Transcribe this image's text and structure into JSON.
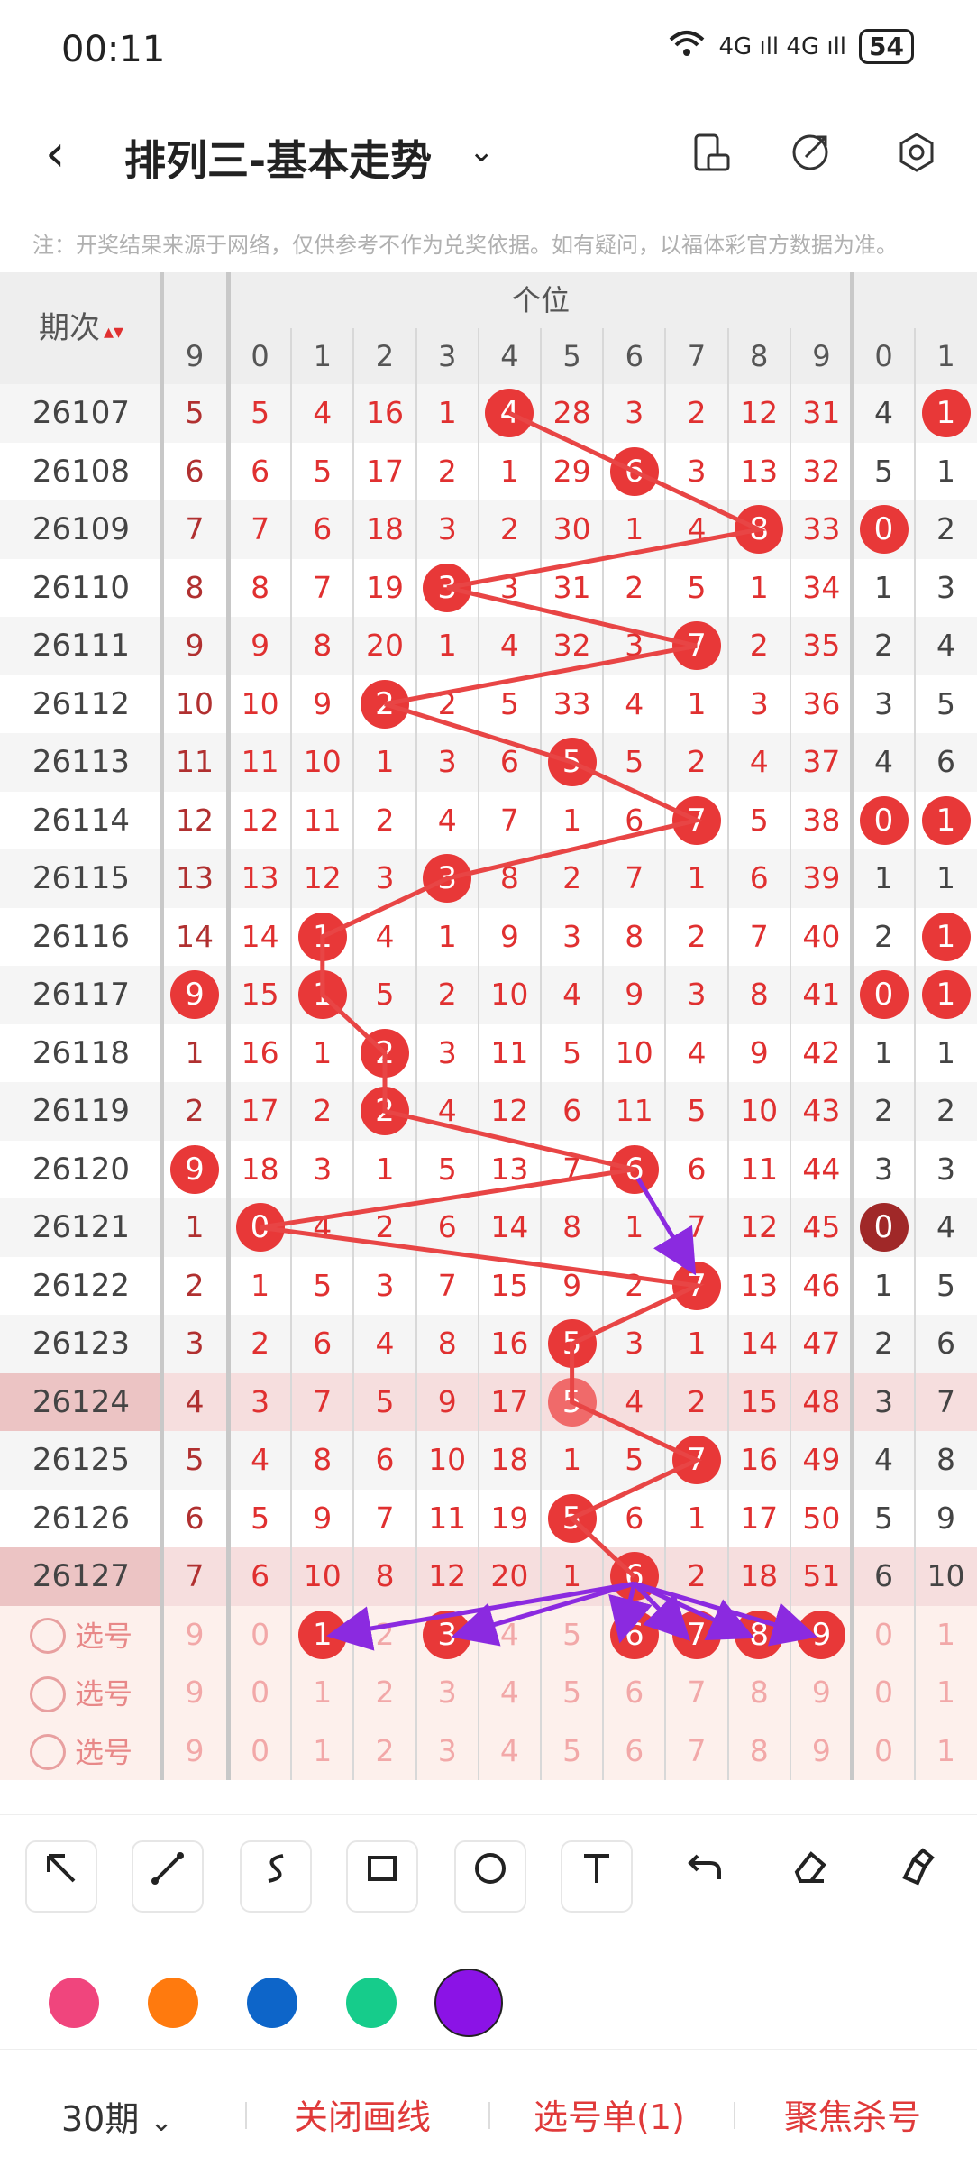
{
  "status_bar": {
    "time": "00:11",
    "signal": "4G ıll 4G ıll",
    "battery": "54"
  },
  "nav": {
    "title": "排列三-基本走势"
  },
  "note": "注：开奖结果来源于网络，仅供参考不作为兑奖依据。如有疑问，以福体彩官方数据为准。",
  "table": {
    "period_header": "期次",
    "group_header": "个位",
    "left_header": "9",
    "digit_headers": [
      "0",
      "1",
      "2",
      "3",
      "4",
      "5",
      "6",
      "7",
      "8",
      "9"
    ],
    "right_headers": [
      "0",
      "1"
    ],
    "rows": [
      {
        "period": "26107",
        "left": "5",
        "cells": [
          "5",
          "4",
          "16",
          "1",
          "4",
          "28",
          "3",
          "2",
          "12",
          "31"
        ],
        "hit": 4,
        "right": [
          "4",
          "1"
        ],
        "rhit": [
          1
        ]
      },
      {
        "period": "26108",
        "left": "6",
        "cells": [
          "6",
          "5",
          "17",
          "2",
          "1",
          "29",
          "6",
          "3",
          "13",
          "32"
        ],
        "hit": 6,
        "right": [
          "5",
          "1"
        ],
        "rhit": []
      },
      {
        "period": "26109",
        "left": "7",
        "cells": [
          "7",
          "6",
          "18",
          "3",
          "2",
          "30",
          "1",
          "4",
          "8",
          "33"
        ],
        "hit": 8,
        "right": [
          "0",
          "2"
        ],
        "rhit": [
          0
        ]
      },
      {
        "period": "26110",
        "left": "8",
        "cells": [
          "8",
          "7",
          "19",
          "3",
          "3",
          "31",
          "2",
          "5",
          "1",
          "34"
        ],
        "hit": 3,
        "right": [
          "1",
          "3"
        ],
        "rhit": []
      },
      {
        "period": "26111",
        "left": "9",
        "cells": [
          "9",
          "8",
          "20",
          "1",
          "4",
          "32",
          "3",
          "7",
          "2",
          "35"
        ],
        "hit": 7,
        "right": [
          "2",
          "4"
        ],
        "rhit": []
      },
      {
        "period": "26112",
        "left": "10",
        "cells": [
          "10",
          "9",
          "2",
          "2",
          "5",
          "33",
          "4",
          "1",
          "3",
          "36"
        ],
        "hit": 2,
        "right": [
          "3",
          "5"
        ],
        "rhit": []
      },
      {
        "period": "26113",
        "left": "11",
        "cells": [
          "11",
          "10",
          "1",
          "3",
          "6",
          "5",
          "5",
          "2",
          "4",
          "37"
        ],
        "hit": 5,
        "right": [
          "4",
          "6"
        ],
        "rhit": []
      },
      {
        "period": "26114",
        "left": "12",
        "cells": [
          "12",
          "11",
          "2",
          "4",
          "7",
          "1",
          "6",
          "7",
          "5",
          "38"
        ],
        "hit": 7,
        "right": [
          "0",
          "1"
        ],
        "rhit": [
          0,
          1
        ]
      },
      {
        "period": "26115",
        "left": "13",
        "cells": [
          "13",
          "12",
          "3",
          "3",
          "8",
          "2",
          "7",
          "1",
          "6",
          "39"
        ],
        "hit": 3,
        "right": [
          "1",
          "1"
        ],
        "rhit": []
      },
      {
        "period": "26116",
        "left": "14",
        "cells": [
          "14",
          "1",
          "4",
          "1",
          "9",
          "3",
          "8",
          "2",
          "7",
          "40"
        ],
        "hit": 1,
        "right": [
          "2",
          "1"
        ],
        "rhit": [
          1
        ]
      },
      {
        "period": "26117",
        "left": "9",
        "lefthit": true,
        "cells": [
          "15",
          "1",
          "5",
          "2",
          "10",
          "4",
          "9",
          "3",
          "8",
          "41"
        ],
        "hit": 1,
        "right": [
          "0",
          "1"
        ],
        "rhit": [
          0,
          1
        ]
      },
      {
        "period": "26118",
        "left": "1",
        "cells": [
          "16",
          "1",
          "2",
          "3",
          "11",
          "5",
          "10",
          "4",
          "9",
          "42"
        ],
        "hit": 2,
        "right": [
          "1",
          "1"
        ],
        "rhit": []
      },
      {
        "period": "26119",
        "left": "2",
        "cells": [
          "17",
          "2",
          "2",
          "4",
          "12",
          "6",
          "11",
          "5",
          "10",
          "43"
        ],
        "hit": 2,
        "right": [
          "2",
          "2"
        ],
        "rhit": []
      },
      {
        "period": "26120",
        "left": "9",
        "lefthit": true,
        "cells": [
          "18",
          "3",
          "1",
          "5",
          "13",
          "7",
          "6",
          "6",
          "11",
          "44"
        ],
        "hit": 6,
        "right": [
          "3",
          "3"
        ],
        "rhit": []
      },
      {
        "period": "26121",
        "left": "1",
        "cells": [
          "0",
          "4",
          "2",
          "6",
          "14",
          "8",
          "1",
          "7",
          "12",
          "45"
        ],
        "hit": 0,
        "right": [
          "0",
          "4"
        ],
        "rhit": [
          0
        ],
        "rdark": true
      },
      {
        "period": "26122",
        "left": "2",
        "cells": [
          "1",
          "5",
          "3",
          "7",
          "15",
          "9",
          "2",
          "7",
          "13",
          "46"
        ],
        "hit": 7,
        "right": [
          "1",
          "5"
        ],
        "rhit": []
      },
      {
        "period": "26123",
        "left": "3",
        "cells": [
          "2",
          "6",
          "4",
          "8",
          "16",
          "5",
          "3",
          "1",
          "14",
          "47"
        ],
        "hit": 5,
        "right": [
          "2",
          "6"
        ],
        "rhit": []
      },
      {
        "period": "26124",
        "left": "4",
        "cells": [
          "3",
          "7",
          "5",
          "9",
          "17",
          "5",
          "4",
          "2",
          "15",
          "48"
        ],
        "hit": 5,
        "right": [
          "3",
          "7"
        ],
        "rhit": [],
        "highlight": true
      },
      {
        "period": "26125",
        "left": "5",
        "cells": [
          "4",
          "8",
          "6",
          "10",
          "18",
          "1",
          "5",
          "7",
          "16",
          "49"
        ],
        "hit": 7,
        "right": [
          "4",
          "8"
        ],
        "rhit": []
      },
      {
        "period": "26126",
        "left": "6",
        "cells": [
          "5",
          "9",
          "7",
          "11",
          "19",
          "5",
          "6",
          "1",
          "17",
          "50"
        ],
        "hit": 5,
        "right": [
          "5",
          "9"
        ],
        "rhit": []
      },
      {
        "period": "26127",
        "left": "7",
        "cells": [
          "6",
          "10",
          "8",
          "12",
          "20",
          "1",
          "6",
          "2",
          "18",
          "51"
        ],
        "hit": 6,
        "right": [
          "6",
          "10"
        ],
        "rhit": [],
        "highlight": true
      }
    ],
    "pick_rows": [
      {
        "label": "选号",
        "left": "9",
        "cells": [
          "0",
          "1",
          "2",
          "3",
          "4",
          "5",
          "6",
          "7",
          "8",
          "9"
        ],
        "right": [
          "0",
          "1"
        ],
        "picked": [
          1,
          3,
          6,
          7,
          8,
          9
        ]
      },
      {
        "label": "选号",
        "left": "9",
        "cells": [
          "0",
          "1",
          "2",
          "3",
          "4",
          "5",
          "6",
          "7",
          "8",
          "9"
        ],
        "right": [
          "0",
          "1"
        ],
        "picked": []
      },
      {
        "label": "选号",
        "left": "9",
        "cells": [
          "0",
          "1",
          "2",
          "3",
          "4",
          "5",
          "6",
          "7",
          "8",
          "9"
        ],
        "right": [
          "0",
          "1"
        ],
        "picked": []
      }
    ]
  },
  "tools": [
    "arrow-tool",
    "line-tool",
    "curve-tool",
    "rectangle-tool",
    "circle-tool",
    "text-tool",
    "undo-tool",
    "eraser-tool",
    "clear-tool"
  ],
  "colors": {
    "pink": "#f0457d",
    "orange": "#ff7a0e",
    "blue": "#0d65c9",
    "green": "#16cc8b",
    "purple": "#8b13e6",
    "line_red": "#e84545",
    "arrow_purple": "#8b2ae0"
  },
  "bottom": {
    "period_select": "30期",
    "close_draw": "关闭画线",
    "pick_list": "选号单(1)",
    "focus_kill": "聚焦杀号"
  }
}
